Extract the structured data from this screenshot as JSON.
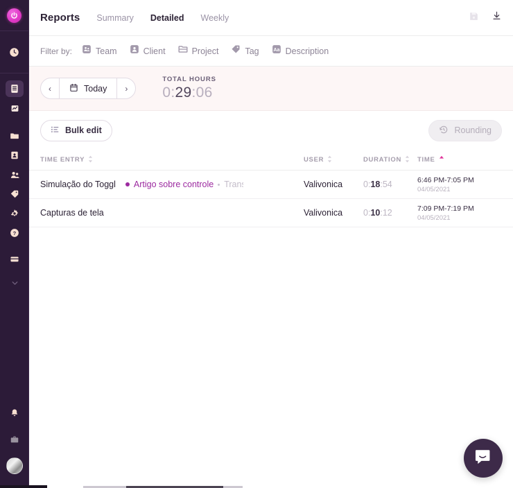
{
  "sidebar": {
    "logo": {
      "name": "toggl-logo",
      "icon": "power-icon"
    },
    "items": [
      {
        "name": "timer",
        "icon": "clock-icon",
        "active": false
      },
      {
        "name": "reports",
        "icon": "reports-document-icon",
        "active": true
      },
      {
        "name": "insights",
        "icon": "chart-insights-icon",
        "active": false
      },
      {
        "name": "projects",
        "icon": "folder-icon",
        "active": false
      },
      {
        "name": "clients",
        "icon": "client-card-icon",
        "active": false
      },
      {
        "name": "team",
        "icon": "team-people-icon",
        "active": false
      },
      {
        "name": "tags",
        "icon": "tag-icon",
        "active": false
      },
      {
        "name": "settings",
        "icon": "gear-icon",
        "active": false
      },
      {
        "name": "help",
        "icon": "question-circle-icon",
        "active": false
      },
      {
        "name": "subscription",
        "icon": "card-icon",
        "active": false
      },
      {
        "name": "expand",
        "icon": "chevron-down-icon",
        "active": false
      }
    ],
    "bottom": [
      {
        "name": "notifications",
        "icon": "bell-icon"
      },
      {
        "name": "workspace",
        "icon": "briefcase-icon"
      },
      {
        "name": "profile",
        "icon": "avatar"
      }
    ]
  },
  "header": {
    "title": "Reports",
    "tabs": [
      {
        "label": "Summary",
        "active": false
      },
      {
        "label": "Detailed",
        "active": true
      },
      {
        "label": "Weekly",
        "active": false
      }
    ],
    "actions": [
      {
        "name": "save-report-icon",
        "icon": "floppy-disk-icon",
        "disabled": true
      },
      {
        "name": "download-icon",
        "icon": "download-arrow-icon",
        "disabled": false
      }
    ]
  },
  "filters": {
    "label": "Filter by:",
    "items": [
      {
        "label": "Team",
        "icon": "team-filter-icon"
      },
      {
        "label": "Client",
        "icon": "client-filter-icon"
      },
      {
        "label": "Project",
        "icon": "project-filter-icon"
      },
      {
        "label": "Tag",
        "icon": "tag-filter-icon"
      },
      {
        "label": "Description",
        "icon": "description-aa-icon"
      }
    ]
  },
  "dateNav": {
    "prev": "‹",
    "next": "›",
    "current": "Today",
    "icon": "calendar-icon"
  },
  "totals": {
    "label": "TOTAL HOURS",
    "prefix": "0:",
    "highlight": "29",
    "suffix": ":06"
  },
  "actionsRow": {
    "bulkEdit": {
      "label": "Bulk edit",
      "icon": "list-edit-icon",
      "disabled": false
    },
    "rounding": {
      "label": "Rounding",
      "icon": "rounding-clock-icon",
      "disabled": true
    }
  },
  "table": {
    "columns": [
      {
        "key": "entry",
        "label": "TIME ENTRY",
        "sorted": false
      },
      {
        "key": "user",
        "label": "USER",
        "sorted": false
      },
      {
        "key": "duration",
        "label": "DURATION",
        "sorted": false
      },
      {
        "key": "time",
        "label": "TIME",
        "sorted": true,
        "direction": "asc"
      }
    ],
    "rows": [
      {
        "description": "Simulação do Toggl",
        "project": "Artigo sobre controle",
        "projectColor": "#9c2aa0",
        "client": "Trans",
        "user": "Valivonica",
        "durPrefix": "0:",
        "durHighlight": "18",
        "durSuffix": ":54",
        "timeRange": "6:46 PM-7:05 PM",
        "date": "04/05/2021"
      },
      {
        "description": "Capturas de tela",
        "project": "",
        "projectColor": "",
        "client": "",
        "user": "Valivonica",
        "durPrefix": "0:",
        "durHighlight": "10",
        "durSuffix": ":12",
        "timeRange": "7:09 PM-7:19 PM",
        "date": "04/05/2021"
      }
    ]
  },
  "chat": {
    "name": "intercom-chat-button",
    "icon": "chat-bubble-smile-icon"
  },
  "colors": {
    "sidebarBg": "#2c1b38",
    "accentPink": "#e039c7",
    "projectPurple": "#9c2aa0",
    "totalsBandBg": "#fdf6f6",
    "chatBg": "#3d2a49"
  }
}
